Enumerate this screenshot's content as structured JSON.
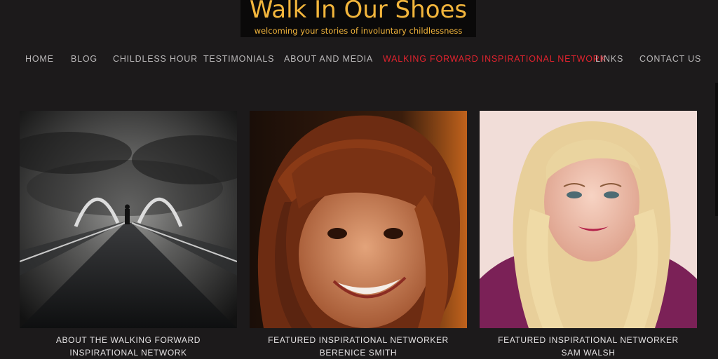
{
  "site": {
    "title": "Walk In Our Shoes",
    "tagline": "welcoming your stories of involuntary childlessness"
  },
  "nav": {
    "items": [
      {
        "label": "HOME",
        "active": false
      },
      {
        "label": "BLOG",
        "active": false
      },
      {
        "label": "CHILDLESS HOUR",
        "active": false
      },
      {
        "label": "TESTIMONIALS",
        "active": false
      },
      {
        "label": "ABOUT AND MEDIA",
        "active": false
      },
      {
        "label": "WALKING FORWARD INSPIRATIONAL NETWORK",
        "active": true
      },
      {
        "label": "LINKS",
        "active": false
      },
      {
        "label": "CONTACT US",
        "active": false
      }
    ]
  },
  "cards": [
    {
      "caption": "ABOUT THE WALKING FORWARD INSPIRATIONAL NETWORK"
    },
    {
      "caption": "FEATURED INSPIRATIONAL NETWORKER BERENICE SMITH"
    },
    {
      "caption": "FEATURED INSPIRATIONAL NETWORKER SAM WALSH"
    }
  ],
  "colors": {
    "background": "#1c1a1b",
    "logo_text": "#f2b53c",
    "nav_text": "#b9b7b8",
    "nav_active": "#e0232e",
    "caption_text": "#e4e2e3"
  }
}
